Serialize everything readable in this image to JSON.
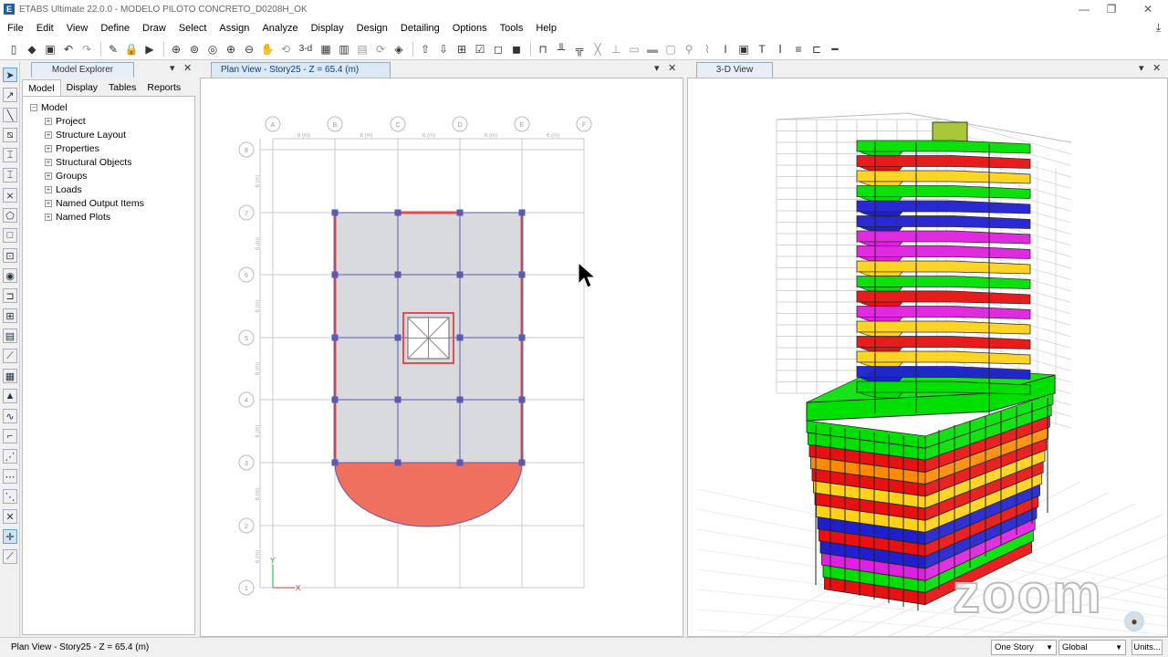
{
  "app": {
    "title": "ETABS Ultimate 22.0.0 - MODELO PILOTO CONCRETO_D0208H_OK",
    "icon_letter": "E"
  },
  "menu": [
    "File",
    "Edit",
    "View",
    "Define",
    "Draw",
    "Select",
    "Assign",
    "Analyze",
    "Display",
    "Design",
    "Detailing",
    "Options",
    "Tools",
    "Help"
  ],
  "explorer": {
    "title": "Model Explorer",
    "tabs": [
      "Model",
      "Display",
      "Tables",
      "Reports"
    ],
    "root": "Model",
    "items": [
      "Project",
      "Structure Layout",
      "Properties",
      "Structural Objects",
      "Groups",
      "Loads",
      "Named Output Items",
      "Named Plots"
    ]
  },
  "plan": {
    "tab_title": "Plan View - Story25 - Z = 65.4 (m)",
    "col_bubbles": [
      "A",
      "B",
      "C",
      "D",
      "E",
      "F"
    ],
    "row_bubbles": [
      "8",
      "7",
      "6",
      "5",
      "4",
      "3",
      "2",
      "1"
    ],
    "spacing_labels": [
      "6 (m)",
      "6 (m)",
      "6 (m)",
      "6 (m)",
      "6 (m)"
    ],
    "axis_x": "X",
    "axis_y": "Y",
    "colors": {
      "slab": "#d9dadd",
      "beam": "#e05050",
      "grid": "#c8c8c8",
      "frame": "#5a5ab0",
      "half_disc": "#f07060"
    }
  },
  "view3d": {
    "tab_title": "3-D View",
    "story_colors": [
      "#e81010",
      "#ffd21a",
      "#1f1fd0",
      "#00e000",
      "#e020e0",
      "#25e0e0",
      "#ff8a00"
    ],
    "watermark": "zoom"
  },
  "status": {
    "text": "Plan View - Story25 - Z = 65.4 (m)",
    "story_option": "One Story",
    "coord_option": "Global",
    "units_label": "Units..."
  }
}
